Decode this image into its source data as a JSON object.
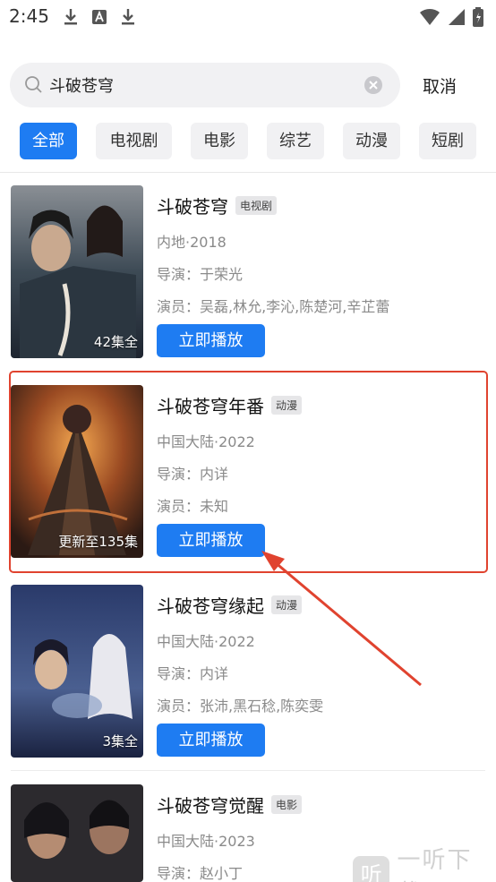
{
  "status_bar": {
    "time": "2:45"
  },
  "search": {
    "value": "斗破苍穹",
    "cancel_label": "取消"
  },
  "tabs": [
    {
      "label": "全部",
      "active": true
    },
    {
      "label": "电视剧",
      "active": false
    },
    {
      "label": "电影",
      "active": false
    },
    {
      "label": "综艺",
      "active": false
    },
    {
      "label": "动漫",
      "active": false
    },
    {
      "label": "短剧",
      "active": false
    }
  ],
  "results": [
    {
      "title": "斗破苍穹",
      "type": "电视剧",
      "region_year": "内地·2018",
      "director": "导演：于荣光",
      "cast": "演员：吴磊,林允,李沁,陈楚河,辛芷蕾",
      "episodes": "42集全",
      "play_label": "立即播放"
    },
    {
      "title": "斗破苍穹年番",
      "type": "动漫",
      "region_year": "中国大陆·2022",
      "director": "导演：内详",
      "cast": "演员：未知",
      "episodes": "更新至135集",
      "play_label": "立即播放"
    },
    {
      "title": "斗破苍穹缘起",
      "type": "动漫",
      "region_year": "中国大陆·2022",
      "director": "导演：内详",
      "cast": "演员：张沛,黑石稔,陈奕雯",
      "episodes": "3集全",
      "play_label": "立即播放"
    },
    {
      "title": "斗破苍穹觉醒",
      "type": "电影",
      "region_year": "中国大陆·2023",
      "director": "导演：赵小丁",
      "cast": "",
      "episodes": "",
      "play_label": ""
    }
  ],
  "watermark": {
    "logo": "听",
    "text": "一听下载"
  },
  "colors": {
    "accent": "#1e7cf2",
    "annotation": "#e0432f"
  }
}
